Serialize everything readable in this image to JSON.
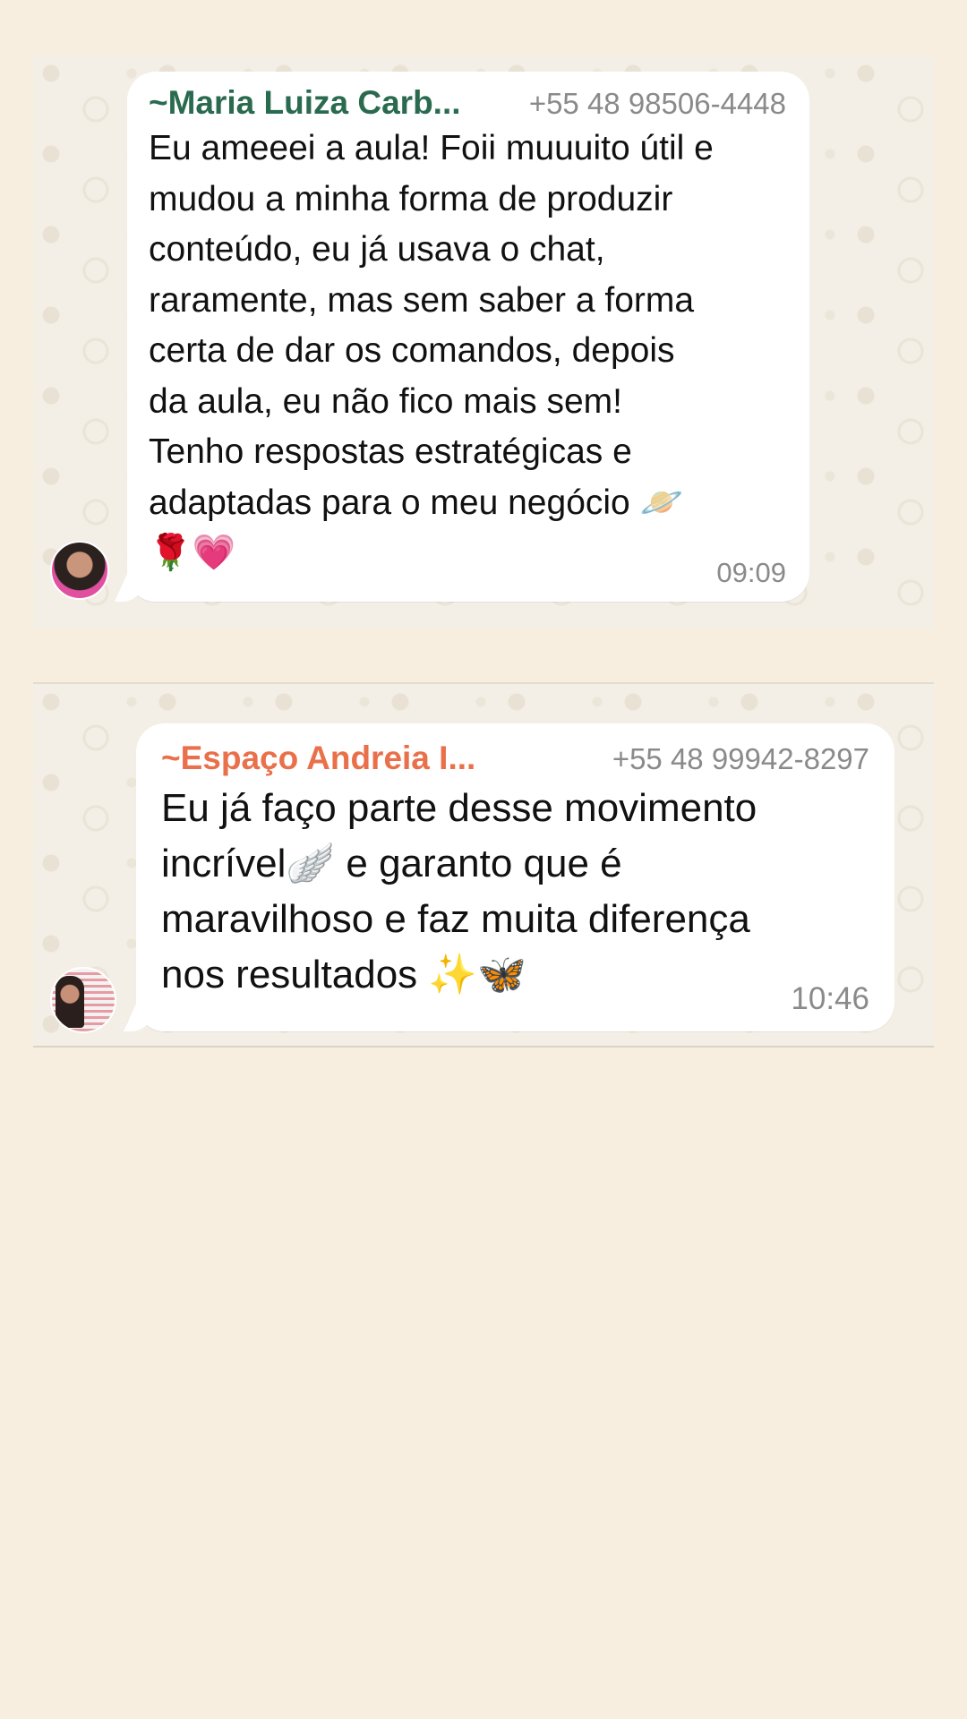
{
  "messages": [
    {
      "sender": "~Maria Luiza Carb...",
      "phone": "+55 48 98506-4448",
      "text": "Eu ameeei a aula! Foii muuuito útil e\nmudou a minha forma de produzir\nconteúdo, eu já usava o chat,\nraramente, mas sem saber a forma\ncerta de dar os comandos, depois\nda aula, eu não fico mais sem!\nTenho respostas estratégicas e\nadaptadas para o meu negócio 🪐\n🌹💗",
      "time": "09:09",
      "sender_color": "#2a6b4f"
    },
    {
      "sender": "~Espaço Andreia I...",
      "phone": "+55 48 99942-8297",
      "text": "Eu já faço parte desse movimento\nincrível🪽 e garanto que é\nmaravilhoso e faz muita diferença\nnos resultados ✨🦋",
      "time": "10:46",
      "sender_color": "#e9704a"
    }
  ],
  "colors": {
    "page_background": "#f8eee0",
    "chat_background": "#f3efe6",
    "bubble": "#ffffff",
    "meta_text": "#8a8a8a"
  }
}
